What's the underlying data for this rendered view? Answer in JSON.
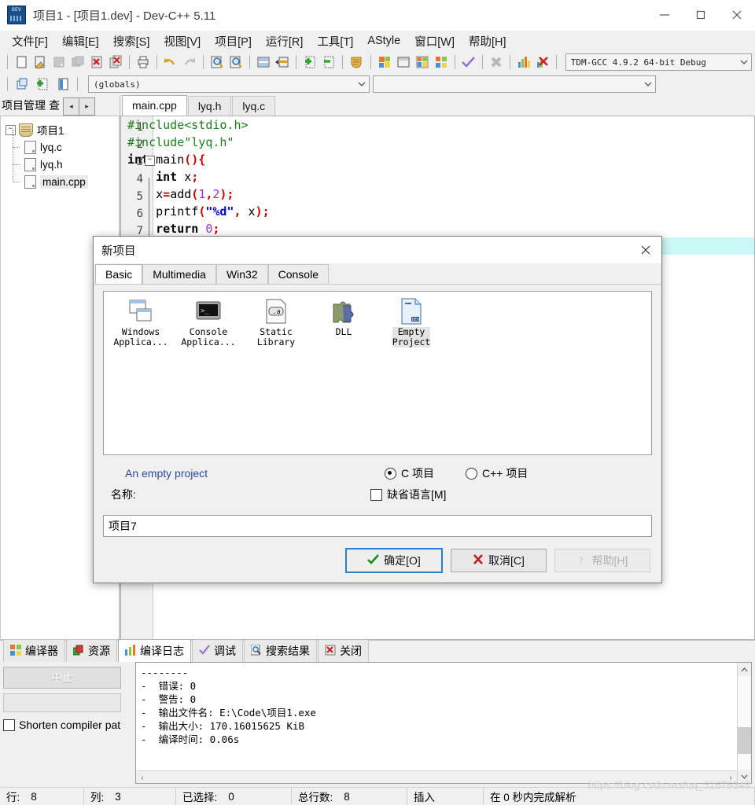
{
  "window": {
    "title": "项目1 - [项目1.dev] - Dev-C++ 5.11",
    "app_icon": "dev-cpp-icon",
    "minimize": "—",
    "maximize": "▢",
    "close": "✕"
  },
  "menubar": {
    "items": [
      {
        "label": "文件[F]",
        "name": "menu-file"
      },
      {
        "label": "编辑[E]",
        "name": "menu-edit"
      },
      {
        "label": "搜索[S]",
        "name": "menu-search"
      },
      {
        "label": "视图[V]",
        "name": "menu-view"
      },
      {
        "label": "项目[P]",
        "name": "menu-project"
      },
      {
        "label": "运行[R]",
        "name": "menu-run"
      },
      {
        "label": "工具[T]",
        "name": "menu-tools"
      },
      {
        "label": "AStyle",
        "name": "menu-astyle"
      },
      {
        "label": "窗口[W]",
        "name": "menu-window"
      },
      {
        "label": "帮助[H]",
        "name": "menu-help"
      }
    ]
  },
  "toolbar": {
    "compiler_select": "TDM-GCC 4.9.2 64-bit Debug",
    "globals_select": "(globals)",
    "members_select": "",
    "icons": [
      "new-file-icon",
      "open-file-icon",
      "save-icon",
      "save-all-icon",
      "close-file-icon",
      "close-all-icon",
      "print-icon",
      "undo-icon",
      "redo-icon",
      "find-icon",
      "replace-icon",
      "goto-line-icon",
      "goto-function-icon",
      "add-to-project-icon",
      "remove-from-project-icon",
      "project-options-icon",
      "compile-icon",
      "run-icon",
      "compile-run-icon",
      "rebuild-icon",
      "syntax-check-icon",
      "stop-icon",
      "profile-icon",
      "delete-profile-icon"
    ],
    "row2_icons": [
      "new-project-icon",
      "add-file-icon",
      "project-panel-icon"
    ]
  },
  "left_panel": {
    "tabs": [
      {
        "label": "项目管理",
        "name": "tab-project-manager",
        "active": true
      },
      {
        "label": "查",
        "name": "tab-classes",
        "active": false
      }
    ],
    "nav_prev": "◂",
    "nav_next": "▸",
    "tree": {
      "root": {
        "label": "项目1",
        "expander": "−",
        "icon": "project-shield-icon"
      },
      "children": [
        {
          "label": "lyq.c",
          "icon": "file-icon",
          "selected": false
        },
        {
          "label": "lyq.h",
          "icon": "file-icon",
          "selected": false
        },
        {
          "label": "main.cpp",
          "icon": "file-icon",
          "selected": true
        }
      ]
    }
  },
  "editor": {
    "tabs": [
      {
        "label": "main.cpp",
        "name": "editor-tab-main-cpp",
        "active": true
      },
      {
        "label": "lyq.h",
        "name": "editor-tab-lyq-h",
        "active": false
      },
      {
        "label": "lyq.c",
        "name": "editor-tab-lyq-c",
        "active": false
      }
    ],
    "lines": [
      {
        "num": "1",
        "fold": "",
        "tokens": [
          {
            "t": "#include<stdio.h>",
            "c": "pre"
          }
        ]
      },
      {
        "num": "2",
        "fold": "",
        "tokens": [
          {
            "t": "#include\"lyq.h\"",
            "c": "pre"
          }
        ]
      },
      {
        "num": "3",
        "fold": "−",
        "tokens": [
          {
            "t": "int",
            "c": "k"
          },
          {
            "t": " main",
            "c": "pl"
          },
          {
            "t": "(){",
            "c": "sym"
          }
        ]
      },
      {
        "num": "4",
        "fold": "",
        "tokens": [
          {
            "t": "    ",
            "c": "pl"
          },
          {
            "t": "int",
            "c": "k"
          },
          {
            "t": " x",
            "c": "pl"
          },
          {
            "t": ";",
            "c": "sym"
          }
        ]
      },
      {
        "num": "5",
        "fold": "",
        "tokens": [
          {
            "t": "    x",
            "c": "pl"
          },
          {
            "t": "=",
            "c": "sym"
          },
          {
            "t": "add",
            "c": "pl"
          },
          {
            "t": "(",
            "c": "sym"
          },
          {
            "t": "1",
            "c": "num"
          },
          {
            "t": ",",
            "c": "sym"
          },
          {
            "t": "2",
            "c": "num"
          },
          {
            "t": ");",
            "c": "sym"
          }
        ]
      },
      {
        "num": "6",
        "fold": "",
        "tokens": [
          {
            "t": "    printf",
            "c": "pl"
          },
          {
            "t": "(",
            "c": "sym"
          },
          {
            "t": "\"%d\"",
            "c": "str"
          },
          {
            "t": ",",
            "c": "sym"
          },
          {
            "t": " x",
            "c": "pl"
          },
          {
            "t": ");",
            "c": "sym"
          }
        ]
      },
      {
        "num": "7",
        "fold": "",
        "tokens": [
          {
            "t": "    ",
            "c": "pl"
          },
          {
            "t": "return",
            "c": "k"
          },
          {
            "t": " ",
            "c": "pl"
          },
          {
            "t": "0",
            "c": "num"
          },
          {
            "t": ";",
            "c": "sym"
          }
        ]
      }
    ],
    "highlight_color": "#ccf7f7"
  },
  "dialog": {
    "title": "新项目",
    "close_label": "✕",
    "tabs": [
      {
        "label": "Basic",
        "name": "dialog-tab-basic",
        "active": true
      },
      {
        "label": "Multimedia",
        "name": "dialog-tab-multimedia",
        "active": false
      },
      {
        "label": "Win32",
        "name": "dialog-tab-win32",
        "active": false
      },
      {
        "label": "Console",
        "name": "dialog-tab-console",
        "active": false
      }
    ],
    "templates": [
      {
        "label": "Windows\nApplica...",
        "icon": "windows-application-icon",
        "selected": false,
        "name": "template-windows-application"
      },
      {
        "label": "Console\nApplica...",
        "icon": "console-application-icon",
        "selected": false,
        "name": "template-console-application"
      },
      {
        "label": "Static\nLibrary",
        "icon": "static-library-icon",
        "selected": false,
        "name": "template-static-library"
      },
      {
        "label": "DLL",
        "icon": "dll-icon",
        "selected": false,
        "name": "template-dll"
      },
      {
        "label": "Empty\nProject",
        "icon": "empty-project-icon",
        "selected": true,
        "name": "template-empty-project"
      }
    ],
    "description": "An empty project",
    "radio_c": {
      "label": "C 项目",
      "checked": true
    },
    "radio_cpp": {
      "label": "C++ 项目",
      "checked": false
    },
    "default_lang": {
      "label": "缺省语言[M]",
      "checked": false
    },
    "name_label": "名称:",
    "name_value": "项目7",
    "name_placeholder": "",
    "buttons": {
      "ok": {
        "label": "确定[O]",
        "icon": "check-icon",
        "enabled": true,
        "focused": true
      },
      "cancel": {
        "label": "取消[C]",
        "icon": "cross-icon",
        "enabled": true
      },
      "help": {
        "label": "帮助[H]",
        "icon": "question-icon",
        "enabled": false
      }
    },
    "accent_color": "#2a7fd4"
  },
  "bottom_panel": {
    "tabs": [
      {
        "label": "编译器",
        "icon": "compiler-icon",
        "active": false,
        "name": "tab-compiler"
      },
      {
        "label": "资源",
        "icon": "resources-icon",
        "active": false,
        "name": "tab-resources"
      },
      {
        "label": "编译日志",
        "icon": "compile-log-icon",
        "active": true,
        "name": "tab-compile-log"
      },
      {
        "label": "调试",
        "icon": "debug-icon",
        "active": false,
        "name": "tab-debug"
      },
      {
        "label": "搜索结果",
        "icon": "search-results-icon",
        "active": false,
        "name": "tab-search-results"
      },
      {
        "label": "关闭",
        "icon": "close-panel-icon",
        "active": false,
        "name": "tab-close"
      }
    ],
    "abort_button": {
      "label": "中止",
      "enabled": false
    },
    "progress_value": "",
    "shorten_checkbox": {
      "label": "Shorten compiler pat",
      "checked": false
    },
    "log_text": "--------\n-  错误: 0\n-  警告: 0\n-  输出文件名: E:\\Code\\项目1.exe\n-  输出大小: 170.16015625 KiB\n-  编译时间: 0.06s",
    "scroll_up": "⌃",
    "scroll_down": "⌄",
    "scroll_left": "‹",
    "scroll_right": "›"
  },
  "statusbar": {
    "cells": [
      {
        "key": "行:",
        "value": "8",
        "name": "status-row"
      },
      {
        "key": "列:",
        "value": "3",
        "name": "status-col"
      },
      {
        "key": "已选择:",
        "value": "0",
        "name": "status-selected"
      },
      {
        "key": "总行数:",
        "value": "8",
        "name": "status-total-lines"
      },
      {
        "key": "插入",
        "value": "",
        "name": "status-insert-mode"
      },
      {
        "key": "在 0 秒内完成解析",
        "value": "",
        "name": "status-parse-time"
      }
    ]
  },
  "watermark": "https://blog.csdn.net/qq_51676348"
}
